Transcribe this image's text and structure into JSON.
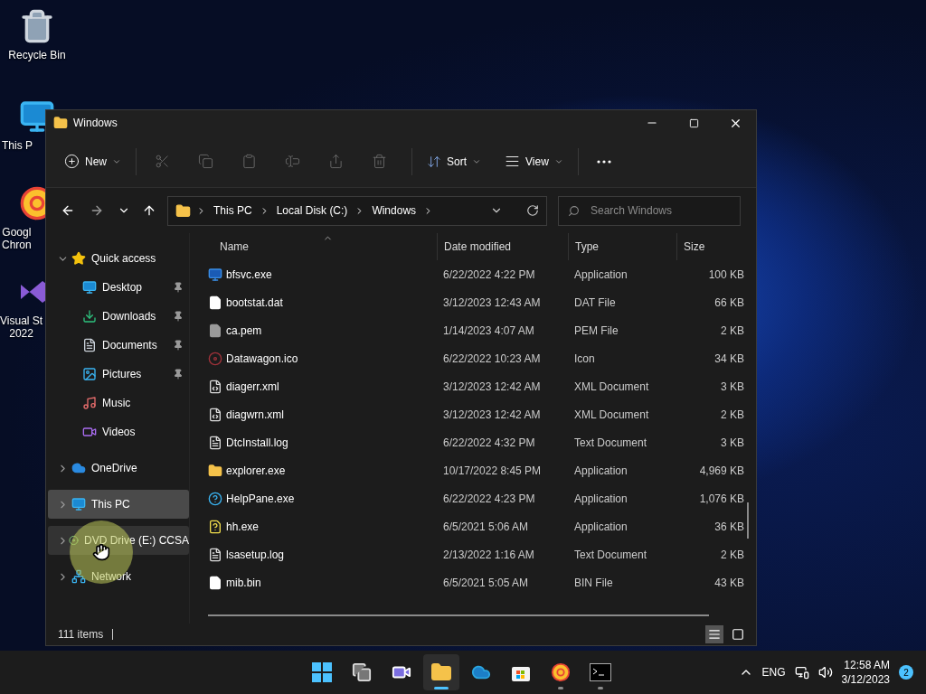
{
  "desktop_icons": [
    {
      "label_lines": [
        "Recycle Bin"
      ]
    },
    {
      "label_lines": [
        "This P"
      ]
    },
    {
      "label_lines": [
        "Googl",
        "Chron"
      ]
    },
    {
      "label_lines": [
        "Visual St",
        "2022"
      ]
    }
  ],
  "window": {
    "title": "Windows"
  },
  "toolbar": {
    "new": {
      "label": "New"
    },
    "actions": [
      {
        "disabled": true
      },
      {
        "disabled": true
      },
      {
        "disabled": true
      },
      {
        "disabled": true
      },
      {
        "disabled": true
      },
      {
        "disabled": true
      }
    ],
    "sort": {
      "label": "Sort"
    },
    "view": {
      "label": "View"
    }
  },
  "address": {
    "crumbs": [
      "This PC",
      "Local Disk (C:)",
      "Windows"
    ],
    "search": {
      "placeholder": "Search Windows"
    }
  },
  "sidebar": {
    "items": [
      {
        "kind": "quick",
        "label": "Quick access",
        "expanded": true,
        "selected": false,
        "hovered": false,
        "children": [
          {
            "kind": "desktop",
            "label": "Desktop",
            "pinned": true,
            "selected": false
          },
          {
            "kind": "downloads",
            "label": "Downloads",
            "pinned": true,
            "selected": false
          },
          {
            "kind": "documents",
            "label": "Documents",
            "pinned": true,
            "selected": false
          },
          {
            "kind": "pictures",
            "label": "Pictures",
            "pinned": true,
            "selected": false
          },
          {
            "kind": "music",
            "label": "Music",
            "pinned": false,
            "selected": false
          },
          {
            "kind": "videos",
            "label": "Videos",
            "pinned": false,
            "selected": false
          }
        ]
      },
      {
        "kind": "onedrive",
        "label": "OneDrive",
        "expanded": false,
        "selected": false,
        "hovered": false
      },
      {
        "kind": "pc",
        "label": "This PC",
        "expanded": false,
        "selected": true,
        "hovered": false
      },
      {
        "kind": "dvd",
        "label": "DVD Drive (E:) CCSA",
        "expanded": false,
        "selected": false,
        "hovered": true
      },
      {
        "kind": "network",
        "label": "Network",
        "expanded": false,
        "selected": false,
        "hovered": false
      }
    ]
  },
  "table": {
    "columns": [
      {
        "label": "Name",
        "sorted": true
      },
      {
        "label": "Date modified",
        "sorted": false
      },
      {
        "label": "Type",
        "sorted": false
      },
      {
        "label": "Size",
        "sorted": false
      }
    ],
    "rows": [
      {
        "kind": "app",
        "name": "bfsvc.exe",
        "date": "6/22/2022 4:22 PM",
        "type": "Application",
        "size": "100 KB"
      },
      {
        "kind": "file",
        "name": "bootstat.dat",
        "date": "3/12/2023 12:43 AM",
        "type": "DAT File",
        "size": "66 KB"
      },
      {
        "kind": "generic",
        "name": "ca.pem",
        "date": "1/14/2023 4:07 AM",
        "type": "PEM File",
        "size": "2 KB"
      },
      {
        "kind": "icon",
        "name": "Datawagon.ico",
        "date": "6/22/2022 10:23 AM",
        "type": "Icon",
        "size": "34 KB"
      },
      {
        "kind": "xml",
        "name": "diagerr.xml",
        "date": "3/12/2023 12:42 AM",
        "type": "XML Document",
        "size": "3 KB"
      },
      {
        "kind": "xml",
        "name": "diagwrn.xml",
        "date": "3/12/2023 12:42 AM",
        "type": "XML Document",
        "size": "2 KB"
      },
      {
        "kind": "text",
        "name": "DtcInstall.log",
        "date": "6/22/2022 4:32 PM",
        "type": "Text Document",
        "size": "3 KB"
      },
      {
        "kind": "explorer",
        "name": "explorer.exe",
        "date": "10/17/2022 8:45 PM",
        "type": "Application",
        "size": "4,969 KB"
      },
      {
        "kind": "help",
        "name": "HelpPane.exe",
        "date": "6/22/2022 4:23 PM",
        "type": "Application",
        "size": "1,076 KB"
      },
      {
        "kind": "hh",
        "name": "hh.exe",
        "date": "6/5/2021 5:06 AM",
        "type": "Application",
        "size": "36 KB"
      },
      {
        "kind": "text",
        "name": "lsasetup.log",
        "date": "2/13/2022 1:16 AM",
        "type": "Text Document",
        "size": "2 KB"
      },
      {
        "kind": "file",
        "name": "mib.bin",
        "date": "6/5/2021 5:05 AM",
        "type": "BIN File",
        "size": "43 KB"
      }
    ]
  },
  "status_bar": {
    "count": "111 items",
    "view_modes": [
      {
        "selected": true
      },
      {
        "selected": false
      }
    ]
  },
  "taskbar": {
    "apps": [
      {
        "running": false,
        "active": false
      },
      {
        "running": false,
        "active": false
      },
      {
        "running": false,
        "active": false
      },
      {
        "running": true,
        "active": true
      },
      {
        "running": false,
        "active": false
      },
      {
        "running": false,
        "active": false
      },
      {
        "running": true,
        "active": false
      },
      {
        "running": true,
        "active": false
      }
    ],
    "language": "ENG",
    "time": "12:58 AM",
    "date": "3/12/2023",
    "notifications": "2"
  }
}
